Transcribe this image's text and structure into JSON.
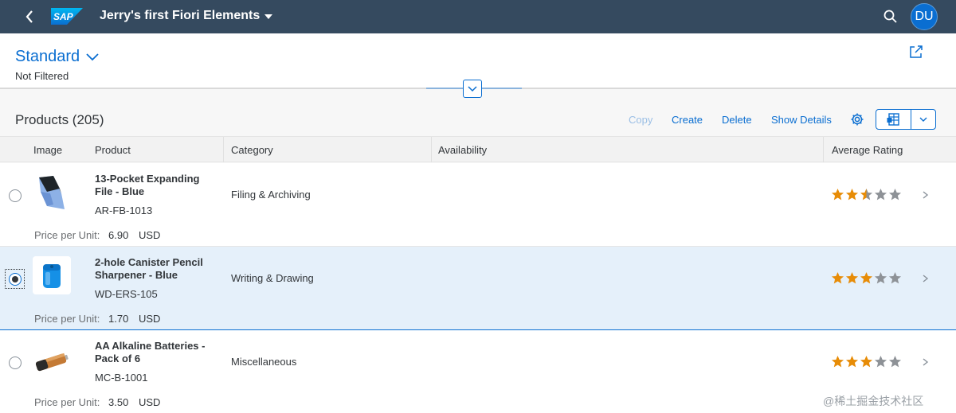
{
  "shell": {
    "title": "Jerry's first Fiori Elements",
    "logo_text": "SAP",
    "avatar_initials": "DU"
  },
  "header": {
    "variant": "Standard",
    "filter_status": "Not Filtered"
  },
  "toolbar": {
    "table_title": "Products (205)",
    "copy_label": "Copy",
    "create_label": "Create",
    "delete_label": "Delete",
    "show_details_label": "Show Details"
  },
  "columns": {
    "image": "Image",
    "product": "Product",
    "category": "Category",
    "availability": "Availability",
    "rating": "Average Rating"
  },
  "rows": [
    {
      "name": "13-Pocket Expanding File - Blue",
      "id": "AR-FB-1013",
      "category": "Filing & Archiving",
      "price_label": "Price per Unit:",
      "price": "6.90",
      "currency": "USD",
      "rating": 2.5,
      "selected": false
    },
    {
      "name": "2-hole Canister Pencil Sharpener - Blue",
      "id": "WD-ERS-105",
      "category": "Writing & Drawing",
      "price_label": "Price per Unit:",
      "price": "1.70",
      "currency": "USD",
      "rating": 3,
      "selected": true
    },
    {
      "name": "AA Alkaline Batteries - Pack of 6",
      "id": "MC-B-1001",
      "category": "Miscellaneous",
      "price_label": "Price per Unit:",
      "price": "3.50",
      "currency": "USD",
      "rating": 3,
      "selected": false
    }
  ],
  "colors": {
    "shell_bg": "#354a5f",
    "accent": "#0a6ed1",
    "star_filled": "#e78c07",
    "star_empty": "#8e9297",
    "selected_row": "#e5f0fa"
  },
  "watermark": "@稀土掘金技术社区"
}
